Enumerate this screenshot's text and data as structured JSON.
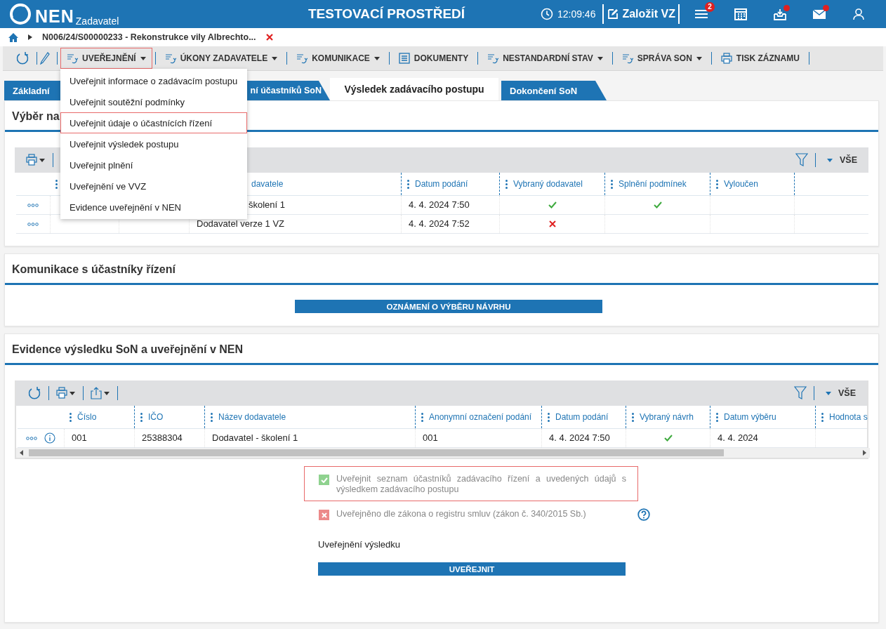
{
  "header": {
    "logo": "NEN",
    "subtitle": "Zadavatel",
    "environment": "TESTOVACÍ PROSTŘEDÍ",
    "time": "12:09:46",
    "create_button": "Založit VZ",
    "notifications_badge": "2",
    "inbox_unread": true,
    "mail_unread": true
  },
  "breadcrumb": {
    "text": "N006/24/S00000233 - Rekonstrukce vily Albrechto..."
  },
  "toolbar": [
    {
      "label": "UVEŘEJNĚNÍ",
      "kind": "menu",
      "dropdown": true,
      "highlighted": true
    },
    {
      "label": "ÚKONY ZADAVATELE",
      "kind": "menu",
      "dropdown": true,
      "highlighted": false
    },
    {
      "label": "KOMUNIKACE",
      "kind": "menu",
      "dropdown": true,
      "highlighted": false
    },
    {
      "label": "DOKUMENTY",
      "kind": "documents",
      "dropdown": false,
      "highlighted": false
    },
    {
      "label": "NESTANDARDNÍ STAV",
      "kind": "menu",
      "dropdown": true,
      "highlighted": false
    },
    {
      "label": "SPRÁVA SON",
      "kind": "menu",
      "dropdown": true,
      "highlighted": false
    },
    {
      "label": "TISK ZÁZNAMU",
      "kind": "print",
      "dropdown": false,
      "highlighted": false
    }
  ],
  "menu": [
    {
      "label": "Uveřejnit informace o zadávacím postupu",
      "highlighted": false
    },
    {
      "label": "Uveřejnit soutěžní podmínky",
      "highlighted": false
    },
    {
      "label": "Uveřejnit údaje o účastnících řízení",
      "highlighted": true
    },
    {
      "label": "Uveřejnit výsledek postupu",
      "highlighted": false
    },
    {
      "label": "Uveřejnit plnění",
      "highlighted": false
    },
    {
      "label": "Uveřejnění ve VVZ",
      "highlighted": false
    },
    {
      "label": "Evidence uveřejnění v NEN",
      "highlighted": false
    }
  ],
  "tabs": [
    {
      "label": "Základní",
      "selected": false
    },
    {
      "label": "ní účastníků SoN",
      "selected": false
    },
    {
      "label": "Výsledek zadávacího postupu",
      "selected": true
    },
    {
      "label": "Dokončení SoN",
      "selected": false
    }
  ],
  "selection_panel": {
    "title": "Výběr na",
    "filter_label": "VŠE",
    "columns": [
      "davatele",
      "Datum podání",
      "Vybraný dodavatel",
      "Splnění podmínek",
      "Vyloučen"
    ],
    "rows": [
      {
        "column_3": "školení 1",
        "submitted": "4. 4. 2024 7:50",
        "selected_supplier": true,
        "conditions_met": true
      },
      {
        "column_3": "Dodavatel verze 1 VZ",
        "submitted": "4. 4. 2024 7:52",
        "selected_supplier": false
      }
    ]
  },
  "communication_panel": {
    "title": "Komunikace s účastníky řízení",
    "button": "OZNÁMENÍ O VÝBĚRU NÁVRHU"
  },
  "evidence_panel": {
    "title": "Evidence výsledku SoN a uveřejnění v NEN",
    "filter_label": "VŠE",
    "columns": [
      "Číslo",
      "IČO",
      "Název dodavatele",
      "Anonymní označení podání",
      "Datum podání",
      "Vybraný návrh",
      "Datum výběru",
      "Hodnota s"
    ],
    "rows": [
      {
        "number": "001",
        "ico": "25388304",
        "supplier": "Dodavatel - školení 1",
        "anonymous_id": "001",
        "submitted": "4. 4. 2024 7:50",
        "selected_design": true,
        "selection_date": "4. 4. 2024"
      }
    ],
    "options": [
      {
        "label": "Uveřejnit seznam účastníků zadávacího řízení a uvedených údajů s výsledkem zadávacího postupu",
        "confirmed": true,
        "highlighted": true
      },
      {
        "label": "Uveřejněno dle zákona o registru smluv (zákon č. 340/2015 Sb.)",
        "confirmed": false,
        "highlighted": false,
        "help": true
      }
    ],
    "result_label": "Uveřejnění výsledku",
    "publish_button": "UVEŘEJNIT"
  }
}
